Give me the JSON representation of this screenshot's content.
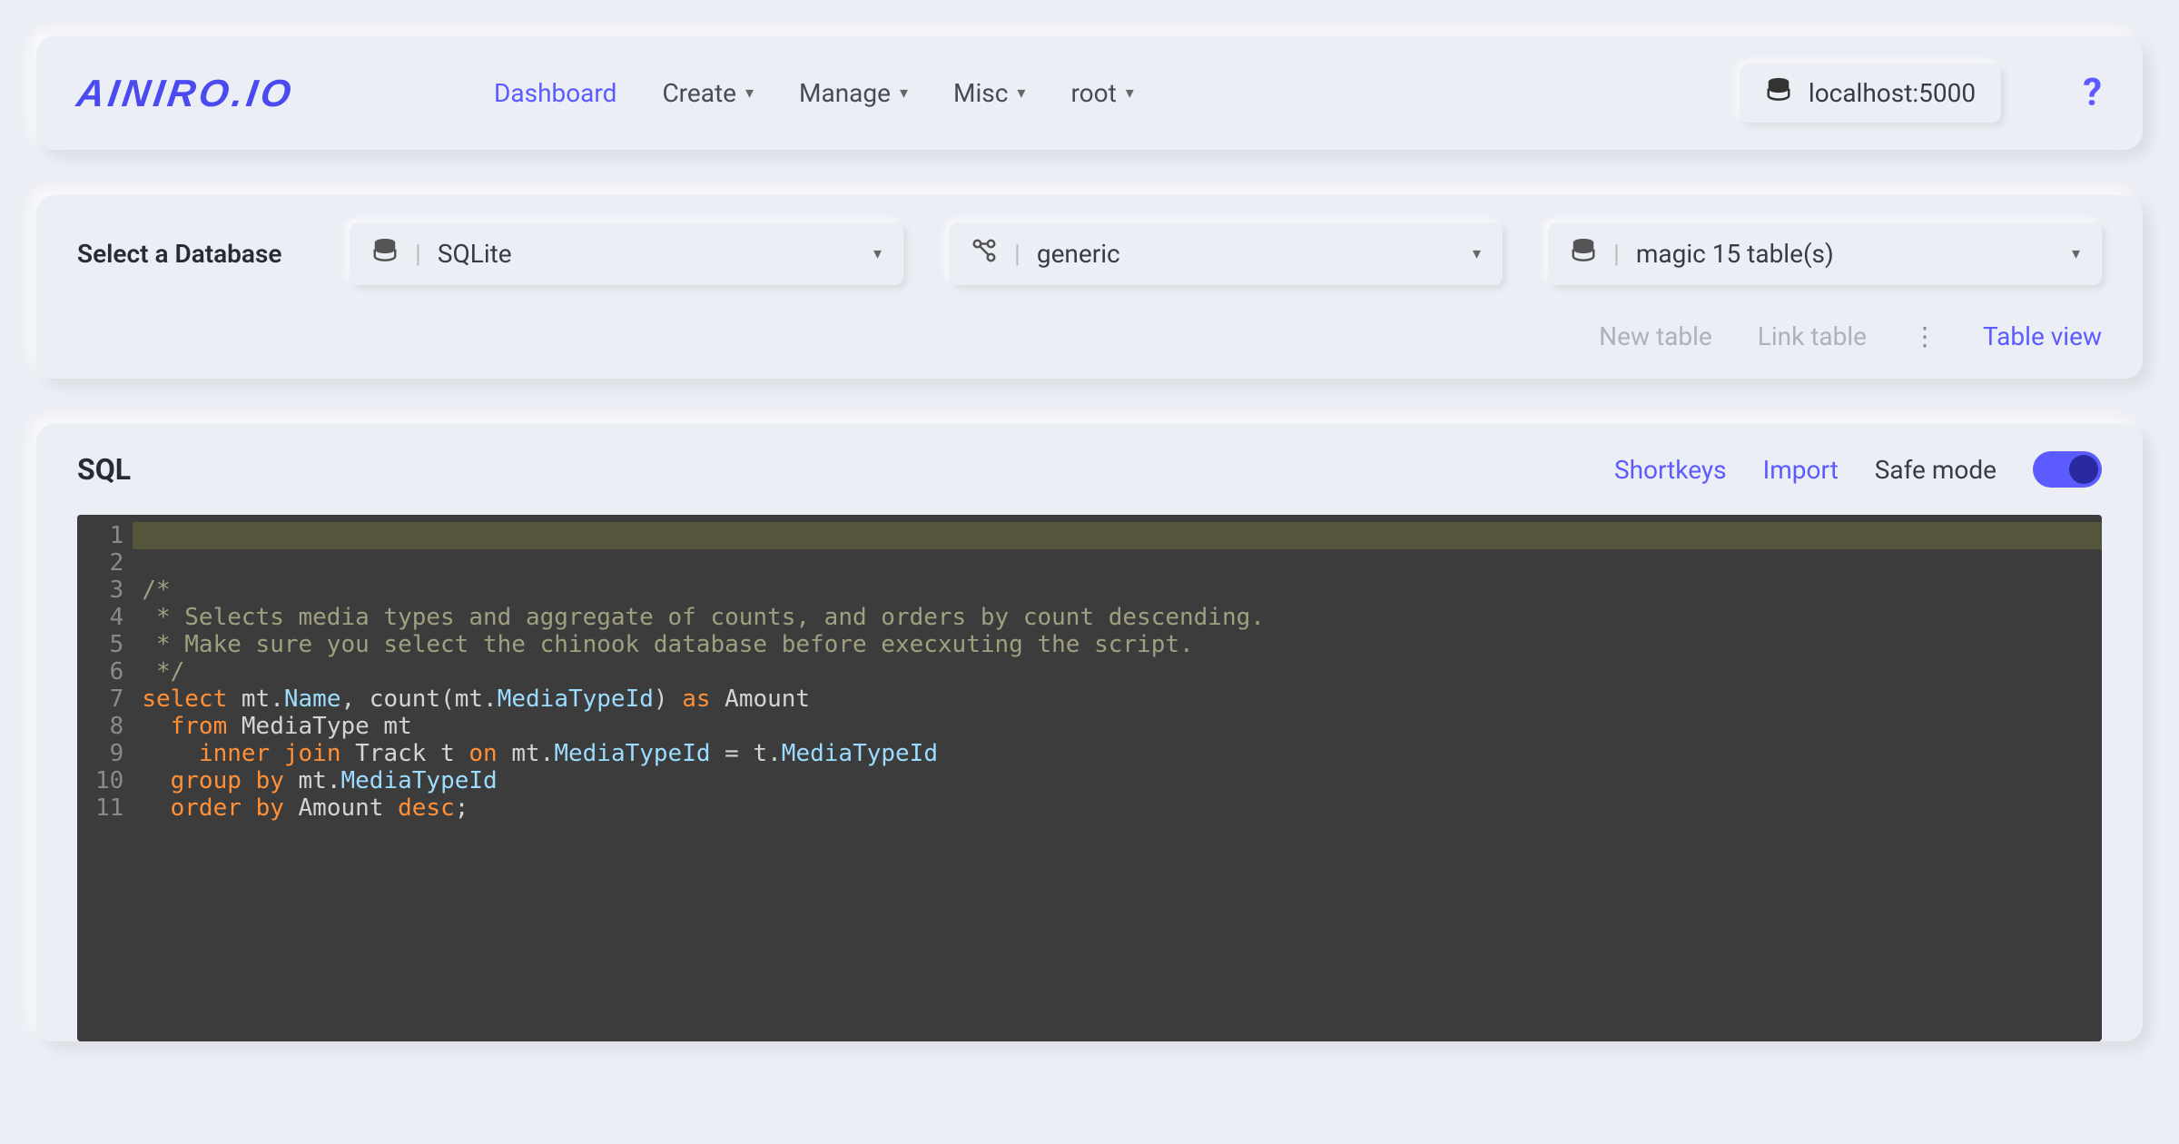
{
  "header": {
    "logo": "AINIRO.IO",
    "nav": {
      "dashboard": "Dashboard",
      "create": "Create",
      "manage": "Manage",
      "misc": "Misc",
      "root": "root"
    },
    "host": "localhost:5000"
  },
  "db": {
    "label": "Select a Database",
    "engine": "SQLite",
    "connection": "generic",
    "tables": "magic 15 table(s)",
    "actions": {
      "new_table": "New table",
      "link_table": "Link table",
      "table_view": "Table view"
    }
  },
  "sql": {
    "title": "SQL",
    "shortkeys": "Shortkeys",
    "import": "Import",
    "safe_mode": "Safe mode",
    "line_numbers": [
      "1",
      "2",
      "3",
      "4",
      "5",
      "6",
      "7",
      "8",
      "9",
      "10",
      "11"
    ],
    "code": {
      "l2": "/*",
      "l3": " * Selects media types and aggregate of counts, and orders by count descending.",
      "l4": " * Make sure you select the chinook database before execxuting the script.",
      "l5": " */",
      "l6": {
        "kw1": "select",
        "t1": " mt",
        "t2": ".",
        "p1": "Name",
        "t3": ", ",
        "fn": "count",
        "t4": "(mt",
        "t5": ".",
        "p2": "MediaTypeId",
        "t6": ") ",
        "kw2": "as",
        "t7": " Amount"
      },
      "l7": {
        "kw1": "from",
        "t1": " MediaType mt"
      },
      "l8": {
        "kw1": "inner",
        "kw2": "join",
        "t1": " Track t ",
        "kw3": "on",
        "t2": " mt",
        "t3": ".",
        "p1": "MediaTypeId",
        "t4": " = t",
        "t5": ".",
        "p2": "MediaTypeId"
      },
      "l9": {
        "kw1": "group",
        "kw2": "by",
        "t1": " mt",
        "t2": ".",
        "p1": "MediaTypeId"
      },
      "l10": {
        "kw1": "order",
        "kw2": "by",
        "t1": " Amount ",
        "kw3": "desc",
        "t2": ";"
      }
    }
  }
}
